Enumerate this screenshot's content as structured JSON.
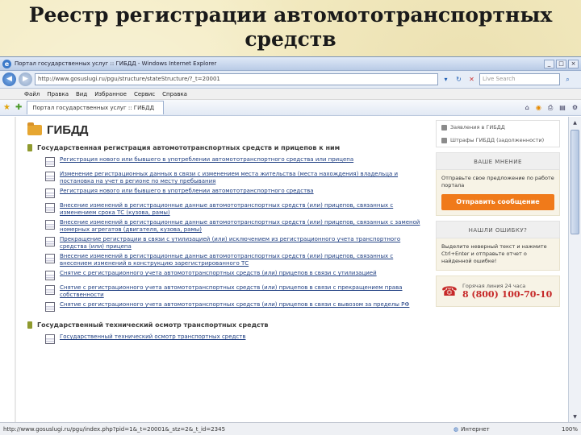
{
  "slide": {
    "title_line1": "Реестр регистрации автомототранспортных",
    "title_line2": "средств"
  },
  "browser": {
    "window_title": "Портал государственных услуг :: ГИБДД - Windows Internet Explorer",
    "window_buttons": [
      "_",
      "□",
      "×"
    ],
    "address": "http://www.gosuslugi.ru/pgu/structure/stateStructure/?_t=20001",
    "search_placeholder": "Live Search",
    "menu": [
      "Файл",
      "Правка",
      "Вид",
      "Избранное",
      "Сервис",
      "Справка"
    ],
    "tab_title": "Портал государственных услуг :: ГИБДД",
    "status_url": "http://www.gosuslugi.ru/pgu/index.php?pid=1&_t=20001&_stz=2&_t_id=2345",
    "status_zone": "Интернет",
    "zoom": "100%"
  },
  "page": {
    "title": "ГИБДД",
    "sections": [
      {
        "title": "Государственная регистрация автомототранспортных средств и прицепов к ним",
        "items": [
          "Регистрация нового или бывшего в употреблении автомототранспортного средства или прицепа",
          "Изменение регистрационных данных в связи с изменением места жительства (места нахождения) владельца и постановка на учет в регионе по месту пребывания",
          "Регистрация нового или бывшего в употреблении автомототранспортного средства",
          "Внесение изменений в регистрационные данные автомототранспортных средств (или) прицепов, связанных с изменением срока ТС (кузова, рамы)",
          "Внесение изменений в регистрационные данные автомототранспортных средств (или) прицепов, связанных с заменой номерных агрегатов (двигателя, кузова, рамы)",
          "Прекращение регистрации в связи с утилизацией (или) исключением из регистрационного учета транспортного средства (или) прицепа",
          "Внесение изменений в регистрационные данные автомототранспортных средств (или) прицепов, связанных с внесением изменений в конструкцию зарегистрированного ТС",
          "Снятие с регистрационного учета автомототранспортных средств (или) прицепов в связи с утилизацией",
          "Снятие с регистрационного учета автомототранспортных средств (или) прицепов в связи с прекращением права собственности",
          "Снятие с регистрационного учета автомототранспортных средств (или) прицепов в связи с вывозом за пределы РФ"
        ]
      },
      {
        "title": "Государственный технический осмотр транспортных средств",
        "items": [
          "Государственный технический осмотр транспортных средств"
        ]
      }
    ]
  },
  "sidebar": {
    "links": [
      "Заявления в ГИБДД",
      "Штрафы ГИБДД (задолженности)"
    ],
    "opinion_header": "ВАШЕ МНЕНИЕ",
    "opinion_text": "Отправьте свое предложение по работе портала",
    "send_button": "Отправить сообщение",
    "error_header": "НАШЛИ ОШИБКУ?",
    "error_text": "Выделите неверный текст и нажмите Ctrl+Enter и отправьте отчет о найденной ошибке!",
    "hotline_label": "Горячая линия 24 часа",
    "hotline_number": "8 (800) 100-70-10"
  },
  "colors": {
    "accent": "#f07a1a",
    "link": "#1f3f82",
    "hotline": "#c62828"
  }
}
